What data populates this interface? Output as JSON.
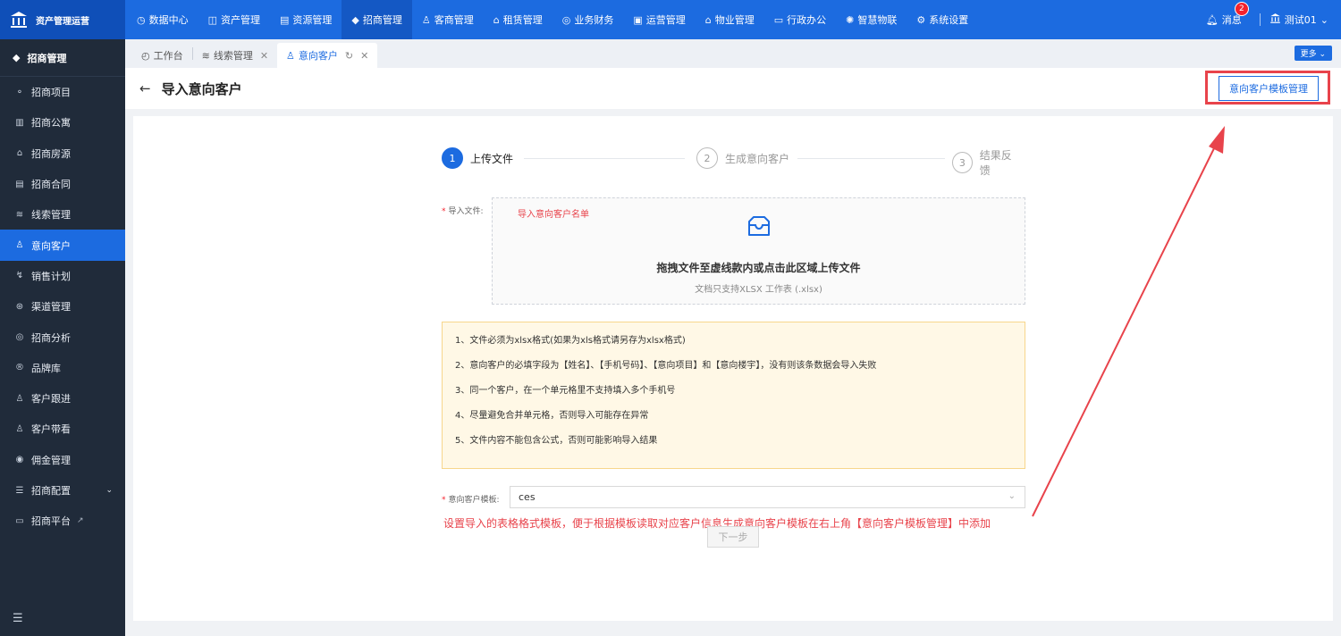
{
  "brand": {
    "name": "资产管理运营"
  },
  "topnav": [
    {
      "icon": "◷",
      "label": "数据中心"
    },
    {
      "icon": "◫",
      "label": "资产管理"
    },
    {
      "icon": "▤",
      "label": "资源管理"
    },
    {
      "icon": "◆",
      "label": "招商管理"
    },
    {
      "icon": "♙",
      "label": "客商管理"
    },
    {
      "icon": "⌂",
      "label": "租赁管理"
    },
    {
      "icon": "◎",
      "label": "业务财务"
    },
    {
      "icon": "▣",
      "label": "运营管理"
    },
    {
      "icon": "⌂",
      "label": "物业管理"
    },
    {
      "icon": "▭",
      "label": "行政办公"
    },
    {
      "icon": "✺",
      "label": "智慧物联"
    },
    {
      "icon": "⚙",
      "label": "系统设置"
    }
  ],
  "top_right": {
    "message_label": "消息",
    "message_count": "2",
    "user_name": "测试01"
  },
  "sidebar": {
    "title": "招商管理",
    "items": [
      {
        "icon": "⚬",
        "label": "招商项目"
      },
      {
        "icon": "▥",
        "label": "招商公寓"
      },
      {
        "icon": "⌂",
        "label": "招商房源"
      },
      {
        "icon": "▤",
        "label": "招商合同"
      },
      {
        "icon": "≋",
        "label": "线索管理"
      },
      {
        "icon": "♙",
        "label": "意向客户"
      },
      {
        "icon": "↯",
        "label": "销售计划"
      },
      {
        "icon": "⊛",
        "label": "渠道管理"
      },
      {
        "icon": "◎",
        "label": "招商分析"
      },
      {
        "icon": "®",
        "label": "品牌库"
      },
      {
        "icon": "♙",
        "label": "客户跟进"
      },
      {
        "icon": "♙",
        "label": "客户带看"
      },
      {
        "icon": "◉",
        "label": "佣金管理"
      },
      {
        "icon": "☰",
        "label": "招商配置"
      },
      {
        "icon": "▭",
        "label": "招商平台"
      }
    ]
  },
  "tabs": [
    {
      "icon": "◴",
      "label": "工作台"
    },
    {
      "icon": "≋",
      "label": "线索管理"
    },
    {
      "icon": "♙",
      "label": "意向客户"
    }
  ],
  "more_label": "更多",
  "page": {
    "title": "导入意向客户",
    "template_button": "意向客户模板管理"
  },
  "steps": [
    {
      "num": "1",
      "label": "上传文件"
    },
    {
      "num": "2",
      "label": "生成意向客户"
    },
    {
      "num": "3",
      "label": "结果反馈"
    }
  ],
  "upload": {
    "label": "导入文件:",
    "annotation": "导入意向客户名单",
    "main_text": "拖拽文件至虚线款内或点击此区域上传文件",
    "sub_text": "文档只支持XLSX 工作表 (.xlsx)"
  },
  "notes": [
    "1、文件必须为xlsx格式(如果为xls格式请另存为xlsx格式)",
    "2、意向客户的必填字段为【姓名】、【手机号码】、【意向项目】和【意向楼宇】，没有则该条数据会导入失败",
    "3、同一个客户，在一个单元格里不支持填入多个手机号",
    "4、尽量避免合并单元格，否则导入可能存在异常",
    "5、文件内容不能包含公式，否则可能影响导入结果"
  ],
  "template_select": {
    "label": "意向客户模板:",
    "value": "ces"
  },
  "tip": "设置导入的表格格式模板，便于根据模板读取对应客户信息生成意向客户模板在右上角【意向客户模板管理】中添加",
  "next_button": "下一步",
  "colors": {
    "primary": "#1c6be0",
    "sidebar": "#202b3a",
    "annotation_red": "#e8434b",
    "notes_bg": "#fff8e6"
  }
}
